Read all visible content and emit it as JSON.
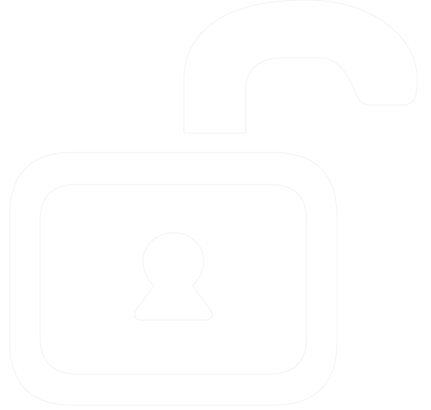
{
  "icon": {
    "name": "unlocked-padlock-icon",
    "fill_color": "#ffffff",
    "outline_color": "#f2f2f2",
    "background_color": "#ffffff"
  }
}
